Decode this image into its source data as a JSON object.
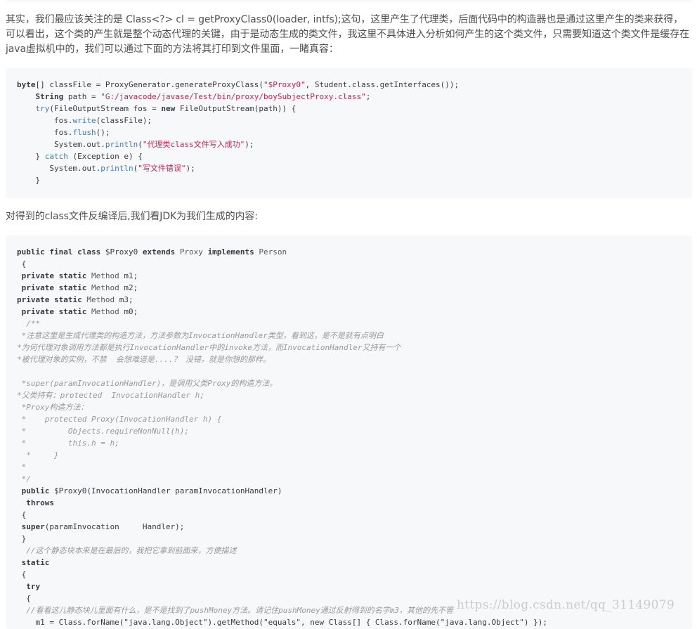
{
  "intro_paragraph": "其实，我们最应该关注的是 Class<?> cl = getProxyClass0(loader, intfs);这句，这里产生了代理类，后面代码中的构造器也是通过这里产生的类来获得，可以看出，这个类的产生就是整个动态代理的关键，由于是动态生成的类文件，我这里不具体进入分析如何产生的这个类文件，只需要知道这个类文件是缓存在java虚拟机中的，我们可以通过下面的方法将其打印到文件里面，一睹真容：",
  "code_block_1": {
    "lines": [
      {
        "parts": [
          {
            "t": "byte",
            "c": "kw"
          },
          {
            "t": "[] classFile = ProxyGenerator.generateProxyClass("
          },
          {
            "t": "\"$Proxy0\"",
            "c": "str"
          },
          {
            "t": ", Student.class.getInterfaces());"
          }
        ]
      },
      {
        "parts": [
          {
            "t": "    "
          },
          {
            "t": "String",
            "c": "kw"
          },
          {
            "t": " path = "
          },
          {
            "t": "\"G:/javacode/javase/Test/bin/proxy/boySubjectProxy.class\"",
            "c": "str"
          },
          {
            "t": ";"
          }
        ]
      },
      {
        "parts": [
          {
            "t": "    "
          },
          {
            "t": "try",
            "c": "fn"
          },
          {
            "t": "(FileOutputStream fos = "
          },
          {
            "t": "new",
            "c": "kw"
          },
          {
            "t": " FileOutputStream(path)) {"
          }
        ]
      },
      {
        "parts": [
          {
            "t": "        fos."
          },
          {
            "t": "write",
            "c": "fn"
          },
          {
            "t": "(classFile);"
          }
        ]
      },
      {
        "parts": [
          {
            "t": "        fos."
          },
          {
            "t": "flush",
            "c": "fn"
          },
          {
            "t": "();"
          }
        ]
      },
      {
        "parts": [
          {
            "t": "        System.out."
          },
          {
            "t": "println",
            "c": "fn"
          },
          {
            "t": "("
          },
          {
            "t": "\"代理类class文件写入成功\"",
            "c": "str"
          },
          {
            "t": ");"
          }
        ]
      },
      {
        "parts": [
          {
            "t": "    } "
          },
          {
            "t": "catch",
            "c": "fn"
          },
          {
            "t": " (Exception e) {"
          }
        ]
      },
      {
        "parts": [
          {
            "t": "       System.out."
          },
          {
            "t": "println",
            "c": "fn"
          },
          {
            "t": "("
          },
          {
            "t": "\"写文件错误\"",
            "c": "str"
          },
          {
            "t": ");"
          }
        ]
      },
      {
        "parts": [
          {
            "t": "    }"
          }
        ]
      }
    ]
  },
  "decompile_paragraph": "对得到的class文件反编译后,我们看JDK为我们生成的内容:",
  "code_block_2": {
    "lines": [
      {
        "parts": [
          {
            "t": "public final class",
            "c": "kw"
          },
          {
            "t": " $Proxy0 "
          },
          {
            "t": "extends",
            "c": "kw"
          },
          {
            "t": " "
          },
          {
            "t": "Proxy",
            "c": "ty"
          },
          {
            "t": " "
          },
          {
            "t": "implements",
            "c": "kw"
          },
          {
            "t": " "
          },
          {
            "t": "Person",
            "c": "ty"
          }
        ]
      },
      {
        "parts": [
          {
            "t": " {"
          }
        ]
      },
      {
        "parts": [
          {
            "t": " "
          },
          {
            "t": "private static",
            "c": "kw"
          },
          {
            "t": " "
          },
          {
            "t": "Method",
            "c": "ty"
          },
          {
            "t": " m1;"
          }
        ]
      },
      {
        "parts": [
          {
            "t": " "
          },
          {
            "t": "private static",
            "c": "kw"
          },
          {
            "t": " "
          },
          {
            "t": "Method",
            "c": "ty"
          },
          {
            "t": " m2;"
          }
        ]
      },
      {
        "parts": [
          {
            "t": "private static",
            "c": "kw"
          },
          {
            "t": " "
          },
          {
            "t": "Method",
            "c": "ty"
          },
          {
            "t": " m3;"
          }
        ]
      },
      {
        "parts": [
          {
            "t": " "
          },
          {
            "t": "private static",
            "c": "kw"
          },
          {
            "t": " "
          },
          {
            "t": "Method",
            "c": "ty"
          },
          {
            "t": " m0;"
          }
        ]
      },
      {
        "parts": [
          {
            "t": "  /**",
            "c": "cm"
          }
        ]
      },
      {
        "parts": [
          {
            "t": " *注意这里是生成代理类的构造方法，方法参数为InvocationHandler类型，看到这，是不是就有点明白",
            "c": "cm"
          }
        ]
      },
      {
        "parts": [
          {
            "t": "*为何代理对象调用方法都是执行InvocationHandler中的invoke方法，而InvocationHandler又持有一个",
            "c": "cm"
          }
        ]
      },
      {
        "parts": [
          {
            "t": "*被代理对象的实例，不禁  会想难道是....？ 没错，就是你想的那样。",
            "c": "cm"
          }
        ]
      },
      {
        "parts": [
          {
            "t": ""
          }
        ]
      },
      {
        "parts": [
          {
            "t": " *super(paramInvocationHandler)，是调用父类Proxy的构造方法。",
            "c": "cm"
          }
        ]
      },
      {
        "parts": [
          {
            "t": "*父类持有：protected  InvocationHandler h;",
            "c": "cm"
          }
        ]
      },
      {
        "parts": [
          {
            "t": " *Proxy构造方法：",
            "c": "cm"
          }
        ]
      },
      {
        "parts": [
          {
            "t": " *    protected Proxy(InvocationHandler h) {",
            "c": "cm"
          }
        ]
      },
      {
        "parts": [
          {
            "t": " *         Objects.requireNonNull(h);",
            "c": "cm"
          }
        ]
      },
      {
        "parts": [
          {
            "t": " *         this.h = h;",
            "c": "cm"
          }
        ]
      },
      {
        "parts": [
          {
            "t": "  *     }",
            "c": "cm"
          }
        ]
      },
      {
        "parts": [
          {
            "t": " *",
            "c": "cm"
          }
        ]
      },
      {
        "parts": [
          {
            "t": " */",
            "c": "cm"
          }
        ]
      },
      {
        "parts": [
          {
            "t": " "
          },
          {
            "t": "public",
            "c": "kw"
          },
          {
            "t": " $Proxy0(InvocationHandler paramInvocationHandler)"
          }
        ]
      },
      {
        "parts": [
          {
            "t": "  "
          },
          {
            "t": "throws",
            "c": "kw"
          }
        ]
      },
      {
        "parts": [
          {
            "t": " {"
          }
        ]
      },
      {
        "parts": [
          {
            "t": " "
          },
          {
            "t": "super",
            "c": "kw"
          },
          {
            "t": "(paramInvocation     Handler);"
          }
        ]
      },
      {
        "parts": [
          {
            "t": " }"
          }
        ]
      },
      {
        "parts": [
          {
            "t": "  //这个静态块本来是在最后的，我把它拿到前面来，方便描述",
            "c": "cm"
          }
        ]
      },
      {
        "parts": [
          {
            "t": " "
          },
          {
            "t": "static",
            "c": "kw"
          }
        ]
      },
      {
        "parts": [
          {
            "t": " {"
          }
        ]
      },
      {
        "parts": [
          {
            "t": "  "
          },
          {
            "t": "try",
            "c": "kw"
          }
        ]
      },
      {
        "parts": [
          {
            "t": "  {"
          }
        ]
      },
      {
        "parts": [
          {
            "t": "  //看看这儿静态块儿里面有什么，是不是找到了pushMoney方法。请记住pushMoney通过反射得到的名字m3，其他的先不管",
            "c": "cm"
          }
        ]
      },
      {
        "parts": [
          {
            "t": "    m1 = Class.forName(\"java.lang.Object\").getMethod(\"equals\", new Class[] { Class.forName(\"java.lang.Object\") });"
          }
        ]
      }
    ]
  },
  "watermark": "https://blog.csdn.net/qq_31149079"
}
